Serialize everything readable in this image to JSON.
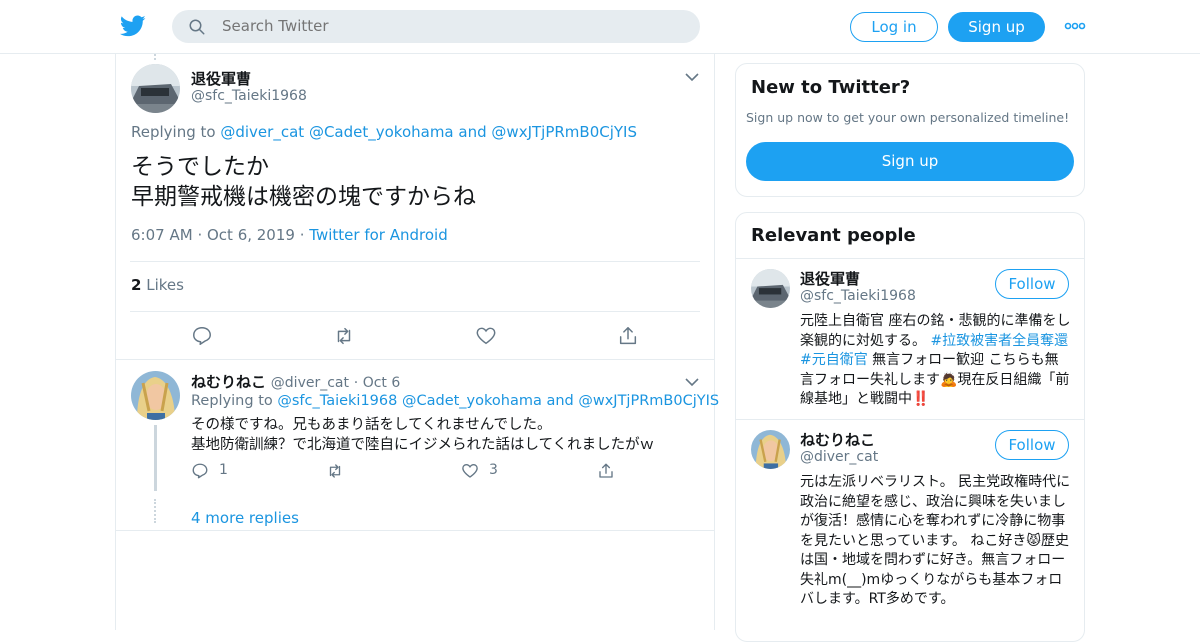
{
  "header": {
    "logo_icon": "twitter-bird-icon",
    "search_placeholder": "Search Twitter",
    "login_label": "Log in",
    "signup_label": "Sign up",
    "more_icon": "more-dots-icon"
  },
  "main_tweet": {
    "name": "退役軍曹",
    "handle": "@sfc_Taieki1968",
    "replying_prefix": "Replying to",
    "replying_to": [
      "@diver_cat",
      "@Cadet_yokohama",
      "@wxJTjPRmB0CjYIS"
    ],
    "replying_and": "and",
    "text_line1": "そうでしたか",
    "text_line2": "早期警戒機は機密の塊ですからね",
    "time": "6:07 AM",
    "date": "Oct 6, 2019",
    "source": "Twitter for Android",
    "likes_count": "2",
    "likes_label": "Likes"
  },
  "reply": {
    "name": "ねむりねこ",
    "handle": "@diver_cat",
    "date": "Oct 6",
    "replying_prefix": "Replying to",
    "replying_to": [
      "@sfc_Taieki1968",
      "@Cadet_yokohama",
      "@wxJTjPRmB0CjYIS"
    ],
    "replying_and": "and",
    "text_line1": "その様ですね。兄もあまり話をしてくれませんでした。",
    "text_line2": "基地防衛訓練？で北海道で陸自にイジメられた話はしてくれましたがｗ",
    "reply_count": "1",
    "retweet_count": "",
    "like_count": "3",
    "more_replies": "4 more replies"
  },
  "sidebar": {
    "new_title": "New to Twitter?",
    "new_sub": "Sign up now to get your own personalized timeline!",
    "signup_label": "Sign up",
    "relevant_title": "Relevant people",
    "follow_label": "Follow",
    "people": [
      {
        "name": "退役軍曹",
        "handle": "@sfc_Taieki1968",
        "bio_part1": "元陸上自衛官 座右の銘・悲観的に準備をし楽観的に対処する。 ",
        "bio_hashtag1": "#拉致被害者全員奪還",
        "bio_space": " ",
        "bio_hashtag2": "#元自衛官",
        "bio_part2": " 無言フォロー歓迎 こちらも無言フォロー失礼します🙇現在反日組織「前線基地」と戦闘中‼️"
      },
      {
        "name": "ねむりねこ",
        "handle": "@diver_cat",
        "bio_part1": "元は左派リベラリスト。 民主党政権時代に政治に絶望を感じ、政治に興味を失いましが復活！感情に心を奪われずに冷静に物事を見たいと思っています。 ねこ好き😾歴史は国・地域を問わずに好き。無言フォロー失礼m(__)mゆっくりながらも基本フォロバします。RT多めです。"
      }
    ]
  },
  "colors": {
    "accent": "#1da1f2",
    "link": "#1b95e0",
    "muted": "#657786",
    "border": "#e6ecf0"
  }
}
